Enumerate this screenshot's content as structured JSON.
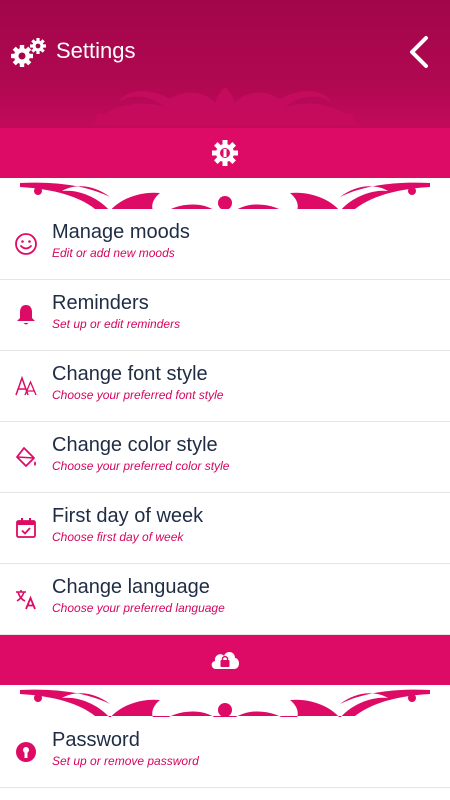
{
  "header": {
    "title": "Settings",
    "title_icon": "gears-icon",
    "back_icon": "chevron-left-icon"
  },
  "colors": {
    "header": "#a2064a",
    "accent": "#dd0a66",
    "text": "#1f2c44",
    "subtext": "#d4075f"
  },
  "sections": [
    {
      "icon": "gear-wrench-icon",
      "items": [
        {
          "label": "Manage moods",
          "sub": "Edit or add new moods",
          "icon": "smiley-icon"
        },
        {
          "label": "Reminders",
          "sub": "Set up or edit reminders",
          "icon": "bell-icon"
        },
        {
          "label": "Change font style",
          "sub": "Choose your preferred font style",
          "icon": "font-icon"
        },
        {
          "label": "Change color style",
          "sub": "Choose your preferred color style",
          "icon": "paint-bucket-icon"
        },
        {
          "label": "First day of week",
          "sub": "Choose first day of week",
          "icon": "calendar-check-icon"
        },
        {
          "label": "Change language",
          "sub": "Choose your preferred language",
          "icon": "translate-icon"
        }
      ]
    },
    {
      "icon": "cloud-lock-icon",
      "items": [
        {
          "label": "Password",
          "sub": "Set up or remove password",
          "icon": "lock-circle-icon"
        }
      ]
    }
  ]
}
